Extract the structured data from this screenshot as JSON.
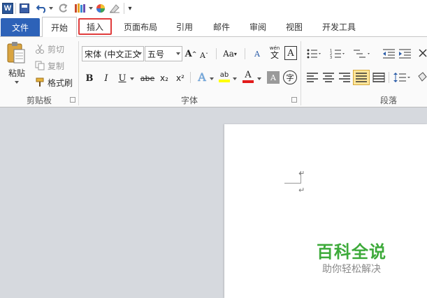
{
  "qat": {
    "app_icon_letter": "W",
    "customize": "▾"
  },
  "tabs": [
    {
      "label": "文件"
    },
    {
      "label": "开始"
    },
    {
      "label": "插入"
    },
    {
      "label": "页面布局"
    },
    {
      "label": "引用"
    },
    {
      "label": "邮件"
    },
    {
      "label": "审阅"
    },
    {
      "label": "视图"
    },
    {
      "label": "开发工具"
    }
  ],
  "clipboard": {
    "paste": "粘贴",
    "cut": "剪切",
    "copy": "复制",
    "format_painter": "格式刷",
    "group_label": "剪贴板"
  },
  "font": {
    "font_name": "宋体 (中文正文",
    "font_size": "五号",
    "grow": "A",
    "shrink": "A",
    "change_case": "Aa",
    "clear": "A",
    "phonetic": "wén",
    "phonetic_char": "文",
    "border_char": "A",
    "bold": "B",
    "italic": "I",
    "underline": "U",
    "strike": "abe",
    "subscript": "x₂",
    "superscript": "x²",
    "highlight": "ab",
    "font_color": "A",
    "shade": "A",
    "enclose": "字",
    "group_label": "字体"
  },
  "paragraph": {
    "group_label": "段落"
  },
  "watermark": {
    "title": "百科全说",
    "subtitle": "助你轻松解决"
  },
  "colors": {
    "file_tab": "#2d62b8",
    "insert_highlight": "#e03c3c",
    "brand_green": "#3daa3a",
    "font_color_bar": "#e21b1b",
    "highlight_bar": "#ffff00"
  }
}
